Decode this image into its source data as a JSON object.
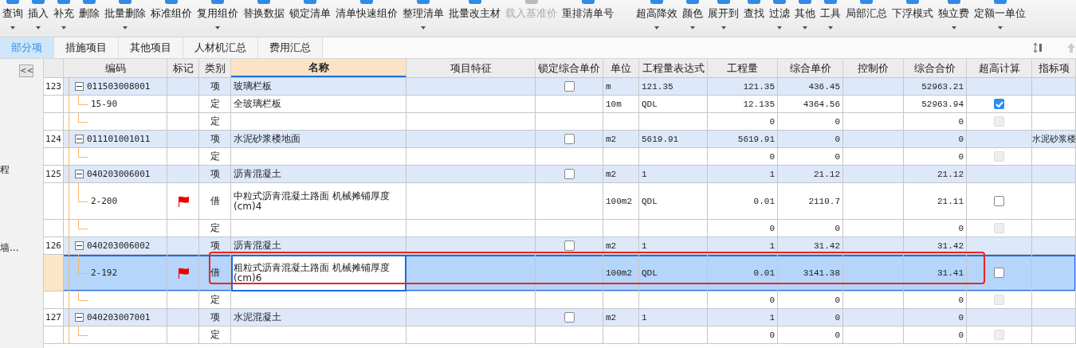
{
  "toolbar": {
    "buttons": [
      {
        "label": "查询",
        "dropdown": true,
        "disabled": false
      },
      {
        "label": "插入",
        "dropdown": true,
        "disabled": false
      },
      {
        "label": "补充",
        "dropdown": true,
        "disabled": false
      },
      {
        "label": "删除",
        "dropdown": false,
        "disabled": false
      },
      {
        "label": "批量删除",
        "dropdown": true,
        "disabled": false
      },
      {
        "label": "标准组价",
        "dropdown": false,
        "disabled": false
      },
      {
        "label": "复用组价",
        "dropdown": true,
        "disabled": false
      },
      {
        "label": "替换数据",
        "dropdown": false,
        "disabled": false
      },
      {
        "label": "锁定清单",
        "dropdown": false,
        "disabled": false
      },
      {
        "label": "清单快速组价",
        "dropdown": false,
        "disabled": false
      },
      {
        "label": "整理清单",
        "dropdown": true,
        "disabled": false
      },
      {
        "label": "批量改主材",
        "dropdown": false,
        "disabled": false
      },
      {
        "label": "载入基准价",
        "dropdown": false,
        "disabled": true
      },
      {
        "label": "重排清单号",
        "dropdown": false,
        "disabled": false
      },
      {
        "label": "超高降效",
        "dropdown": true,
        "disabled": false
      },
      {
        "label": "颜色",
        "dropdown": true,
        "disabled": false
      },
      {
        "label": "展开到",
        "dropdown": true,
        "disabled": false
      },
      {
        "label": "查找",
        "dropdown": false,
        "disabled": false
      },
      {
        "label": "过滤",
        "dropdown": true,
        "disabled": false
      },
      {
        "label": "其他",
        "dropdown": true,
        "disabled": false
      },
      {
        "label": "工具",
        "dropdown": true,
        "disabled": false
      },
      {
        "label": "局部汇总",
        "dropdown": false,
        "disabled": false
      },
      {
        "label": "下浮模式",
        "dropdown": false,
        "disabled": false
      },
      {
        "label": "独立费",
        "dropdown": true,
        "disabled": false
      },
      {
        "label": "定额一单位",
        "dropdown": true,
        "disabled": false
      }
    ]
  },
  "tabs": [
    {
      "label": "部分项",
      "selected": true
    },
    {
      "label": "措施项目",
      "selected": false
    },
    {
      "label": "其他项目",
      "selected": false
    },
    {
      "label": "人材机汇总",
      "selected": false
    },
    {
      "label": "费用汇总",
      "selected": false
    }
  ],
  "sidebar": {
    "collapse_label": "<<",
    "items": [
      "程",
      "墙..."
    ]
  },
  "table": {
    "columns": [
      {
        "sorted": false
      },
      {
        "label": "编码",
        "sorted": false
      },
      {
        "label": "标记",
        "sorted": false
      },
      {
        "label": "类别",
        "sorted": false
      },
      {
        "label": "名称",
        "sorted": true
      },
      {
        "label": "项目特征",
        "sorted": false
      },
      {
        "label": "锁定综合单价",
        "sorted": false
      },
      {
        "label": "单位",
        "sorted": false
      },
      {
        "label": "工程量表达式",
        "sorted": false
      },
      {
        "label": "工程量",
        "sorted": false
      },
      {
        "label": "综合单价",
        "sorted": false
      },
      {
        "label": "控制价",
        "sorted": false
      },
      {
        "label": "综合合价",
        "sorted": false
      },
      {
        "label": "超高计算",
        "sorted": false
      },
      {
        "label": "指标项",
        "sorted": false
      }
    ],
    "rows": [
      {
        "kind": "item",
        "row_no": "123",
        "code": "011503008001",
        "flagged": false,
        "type": "项",
        "name": "玻璃栏板",
        "locked": false,
        "unit": "m",
        "expr": "121.35",
        "qty": "121.35",
        "price": "436.45",
        "total": "52963.21",
        "selected": false,
        "highlighted": false
      },
      {
        "kind": "quota",
        "code": "15-90",
        "flagged": false,
        "type": "定",
        "name": "全玻璃栏板",
        "unit": "10m",
        "expr": "QDL",
        "qty": "12.135",
        "price": "4364.56",
        "total": "52963.94",
        "high_calc": {
          "checked": true,
          "disabled": false
        },
        "selected": false,
        "highlighted": false
      },
      {
        "kind": "quota",
        "code": "",
        "flagged": false,
        "type": "定",
        "name": "",
        "unit": "",
        "expr": "",
        "qty": "0",
        "price": "0",
        "total": "0",
        "high_calc": {
          "checked": false,
          "disabled": true
        },
        "selected": false,
        "highlighted": false
      },
      {
        "kind": "item",
        "row_no": "124",
        "code": "011101001011",
        "flagged": false,
        "type": "项",
        "name": "水泥砂浆楼地面",
        "locked": false,
        "unit": "m2",
        "expr": "5619.91",
        "qty": "5619.91",
        "price": "0",
        "total": "0",
        "indicator": "水泥砂浆楼",
        "selected": false,
        "highlighted": false
      },
      {
        "kind": "quota",
        "code": "",
        "flagged": false,
        "type": "定",
        "name": "",
        "unit": "",
        "expr": "",
        "qty": "0",
        "price": "0",
        "total": "0",
        "high_calc": {
          "checked": false,
          "disabled": true
        },
        "selected": false,
        "highlighted": false
      },
      {
        "kind": "item",
        "row_no": "125",
        "code": "040203006001",
        "flagged": false,
        "type": "项",
        "name": "沥青混凝土",
        "locked": false,
        "unit": "m2",
        "expr": "1",
        "qty": "1",
        "price": "21.12",
        "total": "21.12",
        "selected": false,
        "highlighted": false
      },
      {
        "kind": "quota",
        "code": "2-200",
        "flagged": true,
        "type": "借",
        "name": "中粒式沥青混凝土路面 机械摊铺厚度(cm)4",
        "unit": "100m2",
        "expr": "QDL",
        "qty": "0.01",
        "price": "2110.7",
        "total": "21.11",
        "high_calc": {
          "checked": false,
          "disabled": false
        },
        "selected": false,
        "highlighted": false
      },
      {
        "kind": "quota",
        "code": "",
        "flagged": false,
        "type": "定",
        "name": "",
        "unit": "",
        "expr": "",
        "qty": "0",
        "price": "0",
        "total": "0",
        "high_calc": {
          "checked": false,
          "disabled": true
        },
        "selected": false,
        "highlighted": false
      },
      {
        "kind": "item",
        "row_no": "126",
        "code": "040203006002",
        "flagged": false,
        "type": "项",
        "name": "沥青混凝土",
        "locked": false,
        "unit": "m2",
        "expr": "1",
        "qty": "1",
        "price": "31.42",
        "total": "31.42",
        "selected": false,
        "highlighted": false
      },
      {
        "kind": "quota",
        "code": "2-192",
        "flagged": true,
        "type": "借",
        "name": "粗粒式沥青混凝土路面 机械摊铺厚度(cm)6",
        "unit": "100m2",
        "expr": "QDL",
        "qty": "0.01",
        "price": "3141.38",
        "total": "31.41",
        "high_calc": {
          "checked": false,
          "disabled": false
        },
        "selected": true,
        "highlighted": true
      },
      {
        "kind": "quota",
        "code": "",
        "flagged": false,
        "type": "定",
        "name": "",
        "unit": "",
        "expr": "",
        "qty": "0",
        "price": "0",
        "total": "0",
        "high_calc": {
          "checked": false,
          "disabled": true
        },
        "selected": false,
        "highlighted": false
      },
      {
        "kind": "item",
        "row_no": "127",
        "code": "040203007001",
        "flagged": false,
        "type": "项",
        "name": "水泥混凝土",
        "locked": false,
        "unit": "m2",
        "expr": "1",
        "qty": "1",
        "price": "0",
        "total": "0",
        "selected": false,
        "highlighted": false
      },
      {
        "kind": "quota",
        "code": "",
        "flagged": false,
        "type": "定",
        "name": "",
        "unit": "",
        "expr": "",
        "qty": "0",
        "price": "0",
        "total": "0",
        "high_calc": {
          "checked": false,
          "disabled": true
        },
        "selected": false,
        "highlighted": false
      }
    ]
  }
}
